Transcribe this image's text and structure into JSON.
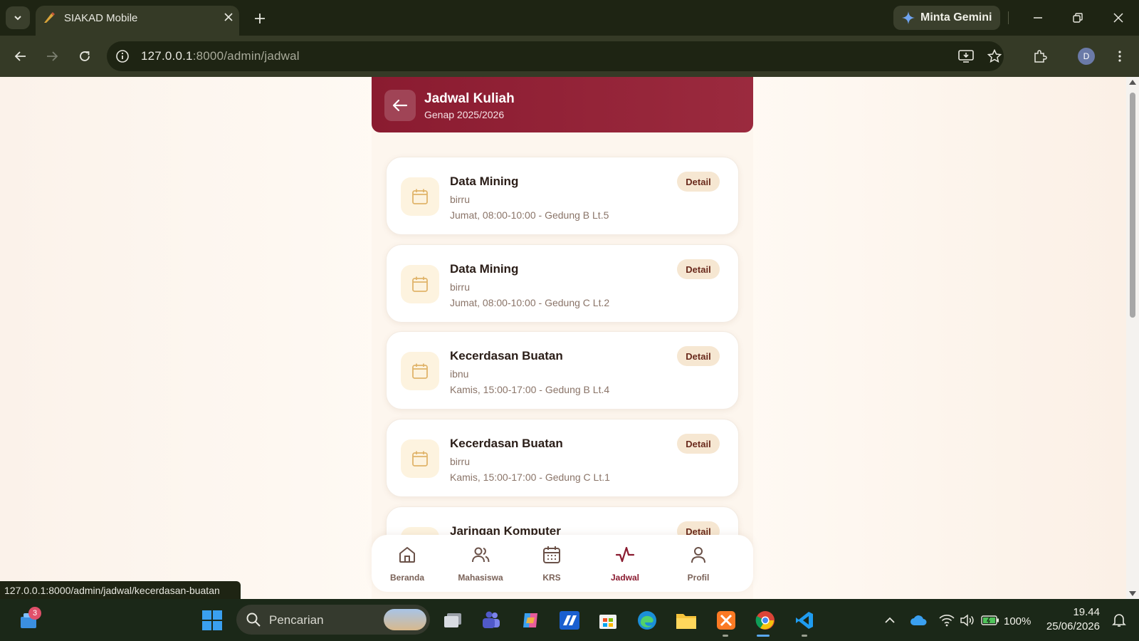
{
  "browser": {
    "tab_title": "SIAKAD Mobile",
    "gemini_label": "Minta Gemini",
    "url_host": "127.0.0.1",
    "url_rest": ":8000/admin/jadwal",
    "profile_initial": "D",
    "status_url": "127.0.0.1:8000/admin/jadwal/kecerdasan-buatan"
  },
  "app": {
    "header": {
      "title": "Jadwal Kuliah",
      "subtitle": "Genap 2025/2026"
    },
    "detail_label": "Detail",
    "schedules": [
      {
        "course": "Data Mining",
        "lecturer": "birru",
        "time": "Jumat, 08:00-10:00 - Gedung B Lt.5"
      },
      {
        "course": "Data Mining",
        "lecturer": "birru",
        "time": "Jumat, 08:00-10:00 - Gedung C Lt.2"
      },
      {
        "course": "Kecerdasan Buatan",
        "lecturer": "ibnu",
        "time": "Kamis, 15:00-17:00 - Gedung B Lt.4"
      },
      {
        "course": "Kecerdasan Buatan",
        "lecturer": "birru",
        "time": "Kamis, 15:00-17:00 - Gedung C Lt.1"
      },
      {
        "course": "Jaringan Komputer",
        "lecturer": "",
        "time": ""
      }
    ],
    "bottom_nav": [
      {
        "label": "Beranda",
        "icon": "home-icon"
      },
      {
        "label": "Mahasiswa",
        "icon": "users-icon"
      },
      {
        "label": "KRS",
        "icon": "calendar-icon"
      },
      {
        "label": "Jadwal",
        "icon": "activity-icon",
        "active": true
      },
      {
        "label": "Profil",
        "icon": "user-icon"
      }
    ],
    "colors": {
      "primary": "#8a1b30",
      "badge_bg": "#f6e7d2",
      "icon_bg": "#fdf3df"
    }
  },
  "taskbar": {
    "notification_count": "3",
    "search_placeholder": "Pencarian",
    "battery": "100%",
    "time": "19.44",
    "date": "25/06/2026"
  }
}
